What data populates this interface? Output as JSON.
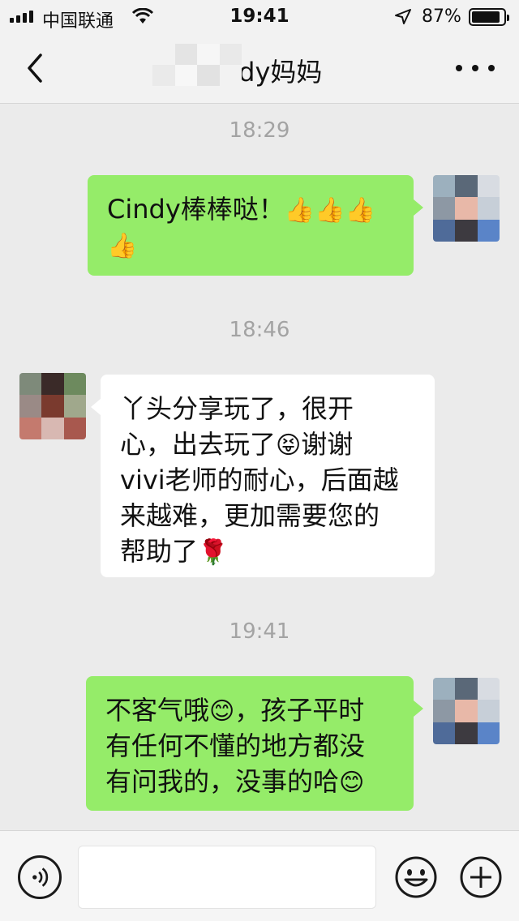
{
  "status_bar": {
    "carrier": "中国联通",
    "time": "19:41",
    "battery_percent": "87%",
    "icons": [
      "signal-icon",
      "wifi-icon",
      "location-arrow-icon",
      "battery-icon"
    ]
  },
  "header": {
    "title": "Cindy妈妈",
    "back_icon": "chevron-left-icon",
    "more_icon": "more-dots-icon"
  },
  "messages": [
    {
      "type": "time",
      "text": "18:29"
    },
    {
      "type": "outgoing",
      "parts": [
        "Cindy棒棒哒！",
        "👍",
        "👍",
        "👍",
        "👍"
      ]
    },
    {
      "type": "time",
      "text": "18:46"
    },
    {
      "type": "incoming",
      "lines": [
        "丫头分享玩了，很开",
        "心，出去玩了",
        "😝",
        "谢谢",
        "vivi老师的耐心，后面越",
        "来越难，更加需要您的",
        "帮助了",
        "🌹"
      ]
    },
    {
      "type": "time",
      "text": "19:41"
    },
    {
      "type": "outgoing",
      "lines": [
        "不客气哦",
        "😊",
        "，孩子平时",
        "有任何不懂的地方都没",
        "有问我的，没事的哈",
        "😊"
      ]
    }
  ],
  "input_bar": {
    "voice_icon": "voice-icon",
    "emoji_icon": "emoji-icon",
    "plus_icon": "plus-icon",
    "input_value": ""
  },
  "colors": {
    "outgoing_bubble": "#95ec69",
    "incoming_bubble": "#ffffff",
    "background": "#ebebeb"
  }
}
